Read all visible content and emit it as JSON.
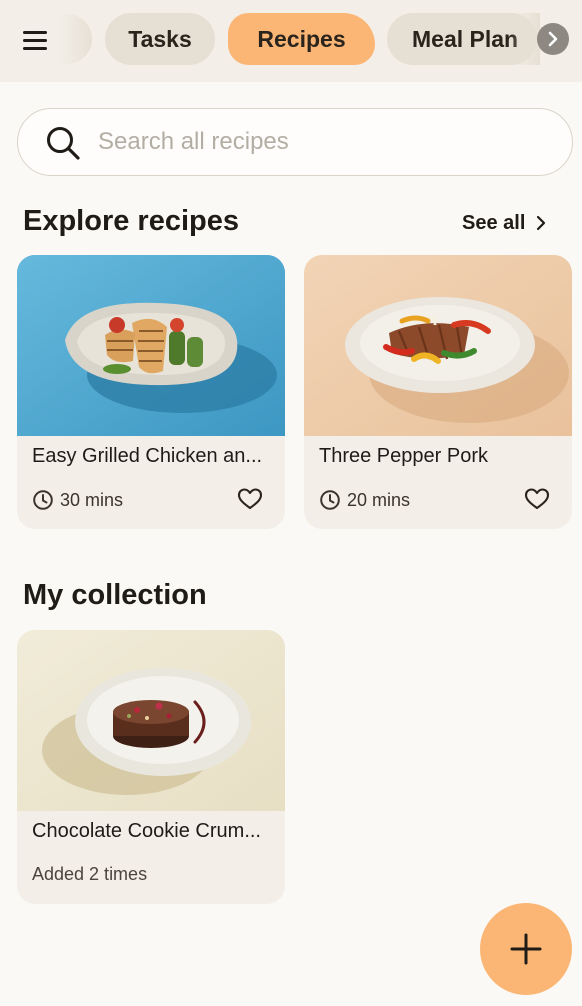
{
  "nav": {
    "tabs": [
      {
        "label": "Tasks",
        "active": false
      },
      {
        "label": "Recipes",
        "active": true
      },
      {
        "label": "Meal Plan",
        "active": false
      }
    ]
  },
  "search": {
    "placeholder": "Search all recipes",
    "value": ""
  },
  "explore": {
    "title": "Explore recipes",
    "see_all": "See all",
    "recipes": [
      {
        "name": "Easy Grilled Chicken an...",
        "time": "30 mins",
        "favorite": false,
        "photo_icon": "grilled-chicken-photo"
      },
      {
        "name": "Three Pepper Pork",
        "time": "20 mins",
        "favorite": false,
        "photo_icon": "pepper-pork-photo"
      }
    ]
  },
  "collection": {
    "title": "My collection",
    "recipes": [
      {
        "name": "Chocolate Cookie Crum...",
        "added": "Added 2 times",
        "photo_icon": "chocolate-dessert-photo"
      }
    ]
  },
  "colors": {
    "accent": "#fbb675",
    "background": "#fbf9f5",
    "card": "#f3efe8",
    "chip": "#e6e0d4"
  }
}
